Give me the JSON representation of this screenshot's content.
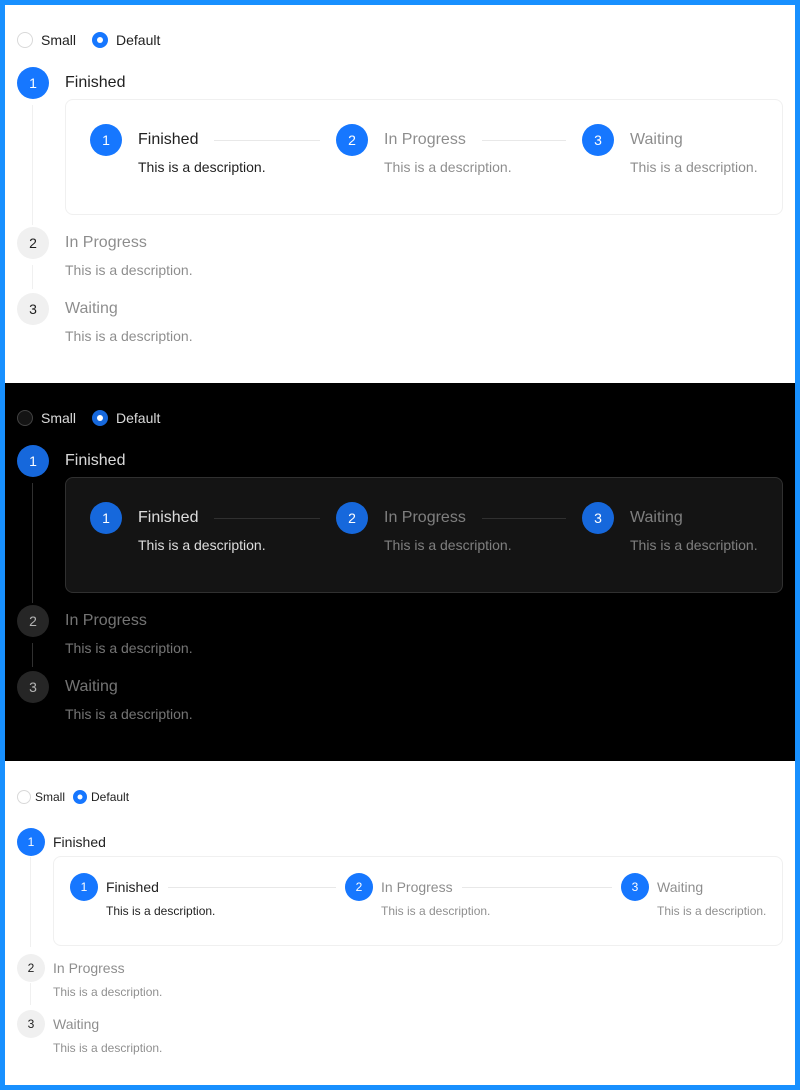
{
  "radio": {
    "small_label": "Small",
    "default_label": "Default",
    "selected": "Default"
  },
  "colors": {
    "frame_border": "#1890ff",
    "primary": "#1677ff",
    "dark_primary": "#1668dc"
  },
  "outer_steps": [
    {
      "number": "1",
      "title": "Finished",
      "status": "finish"
    },
    {
      "number": "2",
      "title": "In Progress",
      "description": "This is a description.",
      "status": "wait"
    },
    {
      "number": "3",
      "title": "Waiting",
      "description": "This is a description.",
      "status": "wait"
    }
  ],
  "inner_steps": [
    {
      "number": "1",
      "title": "Finished",
      "description": "This is a description.",
      "status": "finish"
    },
    {
      "number": "2",
      "title": "In Progress",
      "description": "This is a description.",
      "status": "process"
    },
    {
      "number": "3",
      "title": "Waiting",
      "description": "This is a description.",
      "status": "finish"
    }
  ],
  "sections": [
    {
      "theme": "light",
      "size": "default"
    },
    {
      "theme": "dark",
      "size": "default"
    },
    {
      "theme": "light",
      "size": "small"
    }
  ]
}
